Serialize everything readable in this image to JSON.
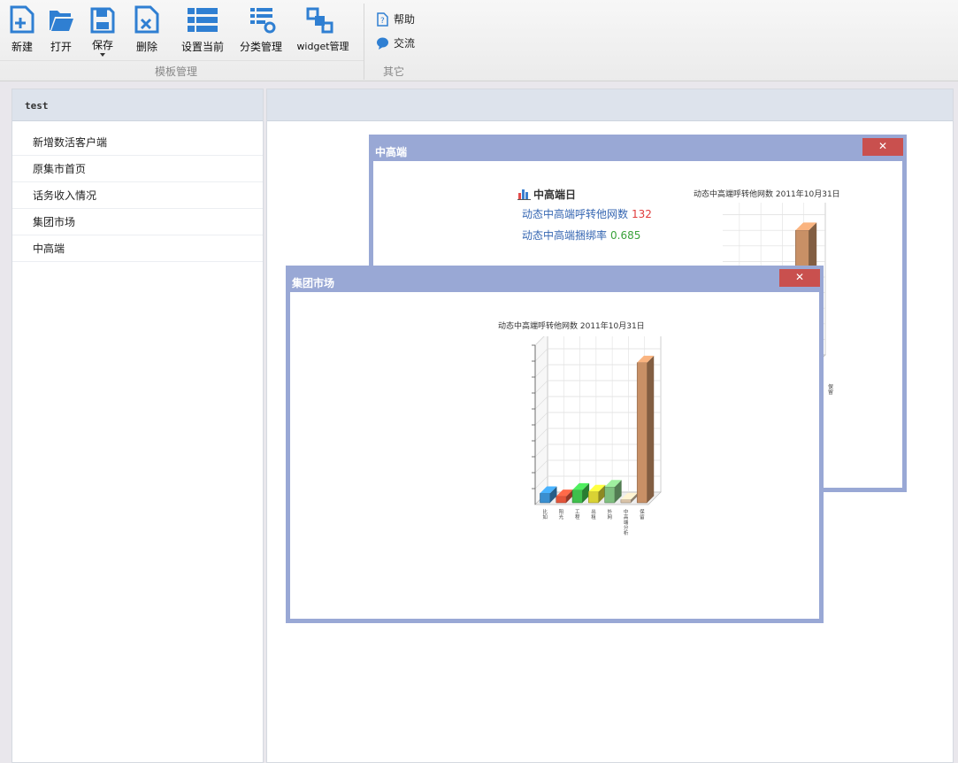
{
  "toolbar": {
    "new_label": "新建",
    "open_label": "打开",
    "save_label": "保存",
    "delete_label": "删除",
    "set_current_label": "设置当前",
    "category_label": "分类管理",
    "widget_label": "widget管理",
    "template_group_label": "模板管理",
    "help_label": "帮助",
    "chat_label": "交流",
    "other_group_label": "其它"
  },
  "sidebar": {
    "title": "test",
    "items": [
      {
        "label": "新增数活客户端"
      },
      {
        "label": "原集市首页"
      },
      {
        "label": "话务收入情况"
      },
      {
        "label": "集团市场"
      },
      {
        "label": "中高端"
      }
    ]
  },
  "windows": {
    "high_end": {
      "title": "中高端",
      "close_icon": "close-icon",
      "kpi_title": "中高端日",
      "kpi_1_label": "动态中高端呼转他网数",
      "kpi_1_value": "132",
      "kpi_2_label": "动态中高端捆绑率",
      "kpi_2_value": "0.685",
      "chart_title": "动态中高端呼转他网数 2011年10月31日",
      "tick_label": "保留"
    },
    "group_market": {
      "title": "集团市场",
      "close_icon": "close-icon",
      "chart_title": "动态中高端呼转他网数 2011年10月31日",
      "tick_labels": [
        "比如",
        "阳光",
        "工程",
        "出租",
        "外网",
        "中高端分析",
        "保留"
      ]
    }
  },
  "colors": {
    "window_border": "#99a8d5",
    "close_button": "#c9504e",
    "panel_header": "#dde3ec",
    "kpi_red": "#e03c3c",
    "kpi_green": "#3aa23a"
  },
  "chart_data": {
    "type": "bar",
    "title": "动态中高端呼转他网数 2011年10月31日",
    "categories": [
      "比如",
      "阳光",
      "工程",
      "出租",
      "外网",
      "中高端分析",
      "保留"
    ],
    "values": [
      6,
      4,
      8,
      7,
      10,
      2,
      88
    ],
    "colors": [
      "#3a8fd0",
      "#e2553a",
      "#3fbf4c",
      "#d9d234",
      "#7fbf7f",
      "#d9c3a8",
      "#c89066"
    ],
    "ylim": [
      0,
      100
    ],
    "grid": true
  }
}
